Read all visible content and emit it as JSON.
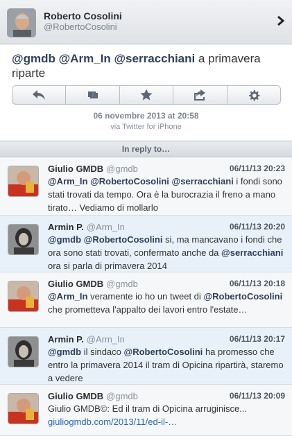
{
  "header": {
    "name": "Roberto Cosolini",
    "handle": "@RobertoCosolini"
  },
  "tweet": {
    "mentions": [
      "@gmdb",
      "@Arm_In",
      "@serracchiani"
    ],
    "text": "a primavera riparte",
    "date": "06 novembre 2013 at 20:58",
    "via": "via Twitter for iPhone"
  },
  "reply_bar": {
    "label": "In reply to…"
  },
  "replies": [
    {
      "name": "Giulio GMDB",
      "handle": "@gmdb",
      "time": "06/11/13 20:23",
      "mentions": [
        "@Arm_In",
        "@RobertoCosolini",
        "@serracchiani"
      ],
      "text": "i fondi sono stati trovati da tempo. Ora è la burocrazia il freno a mano tirato… Vediamo di mollarlo"
    },
    {
      "name": "Armin P.",
      "handle": "@Arm_In",
      "time": "06/11/13 20:20",
      "mentions": [
        "@gmdb",
        "@RobertoCosolini"
      ],
      "text": "si, ma mancavano i fondi che ora sono stati trovati, confermato anche da",
      "mention2": "@serracchiani",
      "text2": "ora si parla di primavera 2014"
    },
    {
      "name": "Giulio GMDB",
      "handle": "@gmdb",
      "time": "06/11/13 20:18",
      "mentions": [
        "@Arm_In"
      ],
      "text": "veramente io ho un tweet di",
      "mention2": "@RobertoCosolini",
      "text2": "che prometteva l'appalto dei lavori entro l'estate…"
    },
    {
      "name": "Armin P.",
      "handle": "@Arm_In",
      "time": "06/11/13 20:17",
      "mentions": [
        "@gmdb"
      ],
      "text": "il sindaco",
      "mention2": "@RobertoCosolini",
      "text2": "ha promesso che entro la primavera 2014 il tram di Opicina ripartirà, staremo a vedere"
    },
    {
      "name": "Giulio GMDB",
      "handle": "@gmdb",
      "time": "06/11/13 20:09",
      "text": "Giulio GMDB©: Ed il tram di Opicina arruginisce...",
      "link": "giuliogmdb.com/2013/11/ed-il-…"
    }
  ],
  "colors": {
    "mention": "#2e3f5a",
    "link": "#2366b8",
    "alt_row": "#e8f1f9"
  },
  "icons": [
    "reply-icon",
    "retweet-icon",
    "star-icon",
    "share-icon",
    "gear-icon",
    "chevron-right-icon"
  ]
}
